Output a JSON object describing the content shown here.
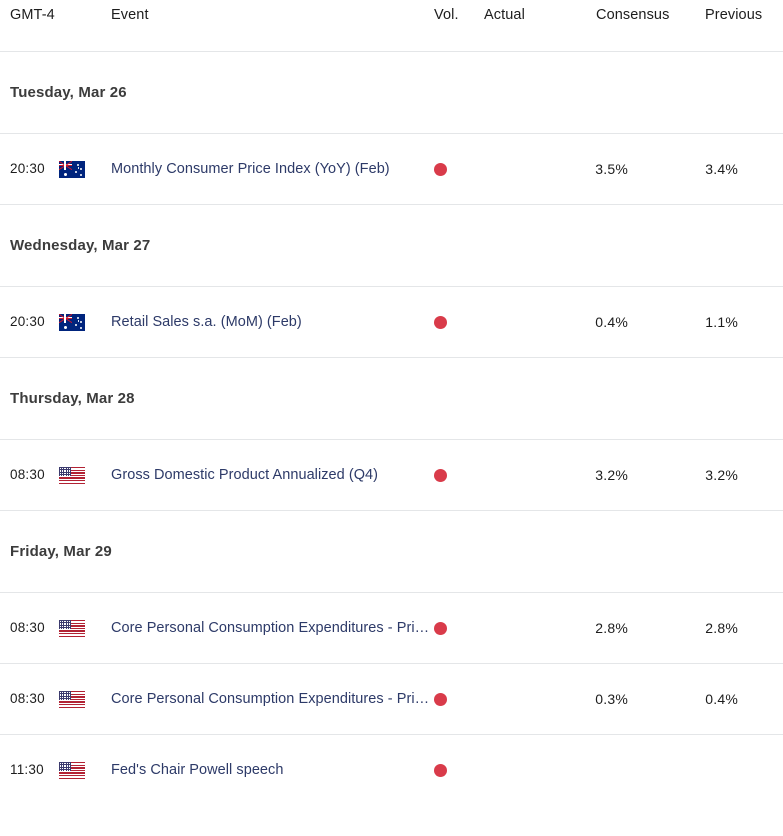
{
  "header": {
    "timezone_label": "GMT-4",
    "event_label": "Event",
    "vol_label": "Vol.",
    "actual_label": "Actual",
    "consensus_label": "Consensus",
    "previous_label": "Previous"
  },
  "colors": {
    "volatility_high": "#d93b4a",
    "event_link": "#2d3a68",
    "date_heading": "#3c3c3c",
    "row_divider": "#e4e6e8",
    "background": "#ffffff"
  },
  "sections": [
    {
      "date": "Tuesday, Mar 26",
      "events": [
        {
          "time": "20:30",
          "flag": "australia-flag-icon",
          "country": "Australia",
          "event": "Monthly Consumer Price Index (YoY) (Feb)",
          "volatility": "high-volatility-icon",
          "actual": "",
          "consensus": "3.5%",
          "previous": "3.4%"
        }
      ]
    },
    {
      "date": "Wednesday, Mar 27",
      "events": [
        {
          "time": "20:30",
          "flag": "australia-flag-icon",
          "country": "Australia",
          "event": "Retail Sales s.a. (MoM) (Feb)",
          "volatility": "high-volatility-icon",
          "actual": "",
          "consensus": "0.4%",
          "previous": "1.1%"
        }
      ]
    },
    {
      "date": "Thursday, Mar 28",
      "events": [
        {
          "time": "08:30",
          "flag": "united-states-flag-icon",
          "country": "United States",
          "event": "Gross Domestic Product Annualized (Q4)",
          "volatility": "high-volatility-icon",
          "actual": "",
          "consensus": "3.2%",
          "previous": "3.2%"
        }
      ]
    },
    {
      "date": "Friday, Mar 29",
      "events": [
        {
          "time": "08:30",
          "flag": "united-states-flag-icon",
          "country": "United States",
          "event": "Core Personal Consumption Expenditures - Price Index (YoY) (Feb)",
          "volatility": "high-volatility-icon",
          "actual": "",
          "consensus": "2.8%",
          "previous": "2.8%"
        },
        {
          "time": "08:30",
          "flag": "united-states-flag-icon",
          "country": "United States",
          "event": "Core Personal Consumption Expenditures - Price Index (MoM) (Feb)",
          "volatility": "high-volatility-icon",
          "actual": "",
          "consensus": "0.3%",
          "previous": "0.4%"
        },
        {
          "time": "11:30",
          "flag": "united-states-flag-icon",
          "country": "United States",
          "event": "Fed's Chair Powell speech",
          "volatility": "high-volatility-icon",
          "actual": "",
          "consensus": "",
          "previous": ""
        }
      ]
    }
  ]
}
